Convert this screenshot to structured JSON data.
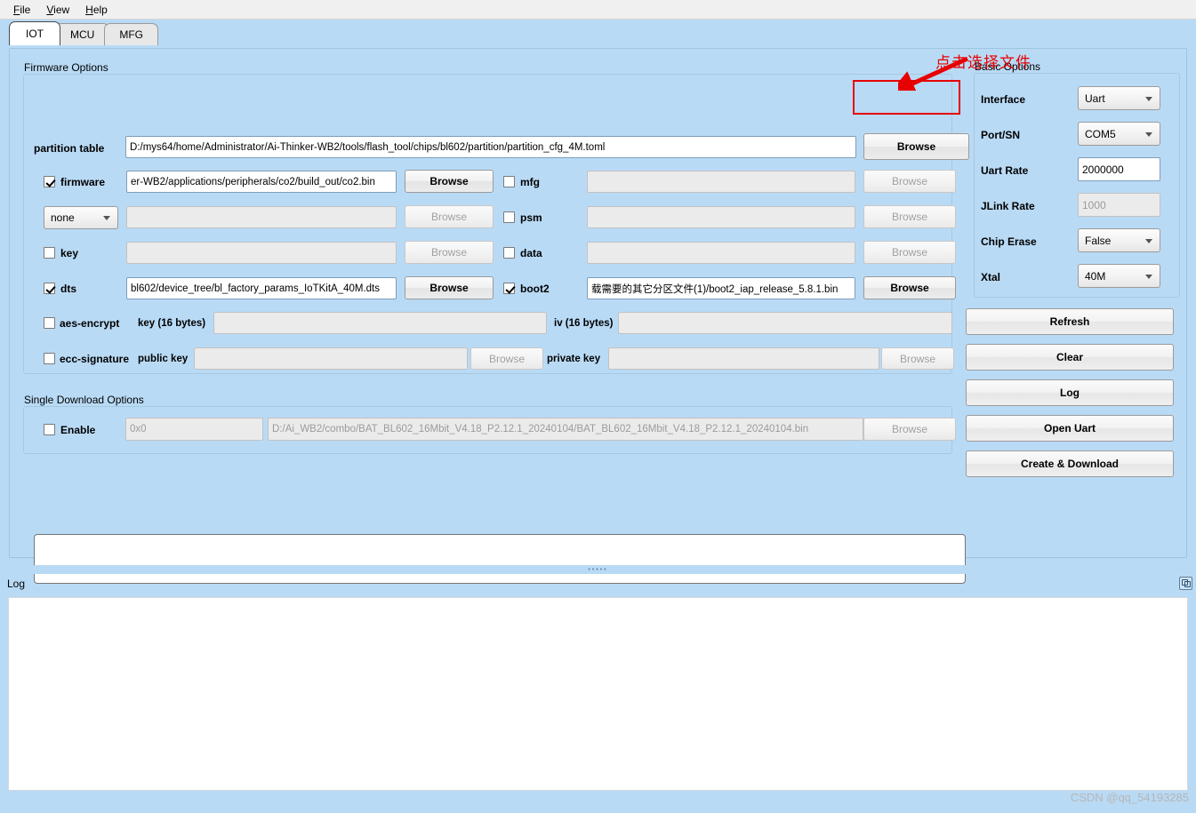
{
  "colors": {
    "background": "#b9daf5",
    "accent_red": "#e60000",
    "panel_white": "#ffffff",
    "disabled_text": "#9b9b9b"
  },
  "menubar": {
    "items": [
      {
        "label": "File",
        "accel": "F"
      },
      {
        "label": "View",
        "accel": "V"
      },
      {
        "label": "Help",
        "accel": "H"
      }
    ]
  },
  "tabs": [
    {
      "label": "IOT",
      "active": true
    },
    {
      "label": "MCU",
      "active": false
    },
    {
      "label": "MFG",
      "active": false
    }
  ],
  "firmware_options": {
    "title": "Firmware Options",
    "partition_table": {
      "label": "partition table",
      "value": "D:/mys64/home/Administrator/Ai-Thinker-WB2/tools/flash_tool/chips/bl602/partition/partition_cfg_4M.toml",
      "browse_label": "Browse"
    },
    "rows_left": [
      {
        "name": "firmware",
        "label": "firmware",
        "checked": true,
        "is_combo": false,
        "value": "er-WB2/applications/peripherals/co2/build_out/co2.bin",
        "browse_label": "Browse",
        "browse_enabled": true
      },
      {
        "name": "none-select",
        "label": "none",
        "checked": false,
        "is_combo": true,
        "value": "",
        "browse_label": "Browse",
        "browse_enabled": false
      },
      {
        "name": "key",
        "label": "key",
        "checked": false,
        "is_combo": false,
        "value": "",
        "browse_label": "Browse",
        "browse_enabled": false
      },
      {
        "name": "dts",
        "label": "dts",
        "checked": true,
        "is_combo": false,
        "value": "bl602/device_tree/bl_factory_params_IoTKitA_40M.dts",
        "browse_label": "Browse",
        "browse_enabled": true
      }
    ],
    "rows_right": [
      {
        "name": "mfg",
        "label": "mfg",
        "checked": false,
        "value": "",
        "browse_label": "Browse",
        "browse_enabled": false
      },
      {
        "name": "psm",
        "label": "psm",
        "checked": false,
        "value": "",
        "browse_label": "Browse",
        "browse_enabled": false
      },
      {
        "name": "data",
        "label": "data",
        "checked": false,
        "value": "",
        "browse_label": "Browse",
        "browse_enabled": false
      },
      {
        "name": "boot2",
        "label": "boot2",
        "checked": true,
        "value": "载需要的其它分区文件(1)/boot2_iap_release_5.8.1.bin",
        "browse_label": "Browse",
        "browse_enabled": true
      }
    ],
    "aes_encrypt": {
      "label": "aes-encrypt",
      "checked": false,
      "key_label": "key (16 bytes)",
      "key_value": "",
      "iv_label": "iv (16 bytes)",
      "iv_value": ""
    },
    "ecc_signature": {
      "label": "ecc-signature",
      "checked": false,
      "public_key_label": "public key",
      "public_key_value": "",
      "public_browse_label": "Browse",
      "private_key_label": "private key",
      "private_key_value": "",
      "private_browse_label": "Browse"
    }
  },
  "single_download_options": {
    "title": "Single Download Options",
    "enable_label": "Enable",
    "enabled": false,
    "address_placeholder": "0x0",
    "address_value": "",
    "file_value": "D:/Ai_WB2/combo/BAT_BL602_16Mbit_V4.18_P2.12.1_20240104/BAT_BL602_16Mbit_V4.18_P2.12.1_20240104.bin",
    "browse_label": "Browse"
  },
  "basic_options": {
    "title": "Basic Options",
    "fields": [
      {
        "name": "interface",
        "label": "Interface",
        "value": "Uart",
        "type": "combo",
        "enabled": true
      },
      {
        "name": "port-sn",
        "label": "Port/SN",
        "value": "COM5",
        "type": "combo",
        "enabled": true
      },
      {
        "name": "uart-rate",
        "label": "Uart Rate",
        "value": "2000000",
        "type": "text",
        "enabled": true
      },
      {
        "name": "jlink-rate",
        "label": "JLink Rate",
        "value": "1000",
        "type": "text",
        "enabled": false
      },
      {
        "name": "chip-erase",
        "label": "Chip Erase",
        "value": "False",
        "type": "combo",
        "enabled": true
      },
      {
        "name": "xtal",
        "label": "Xtal",
        "value": "40M",
        "type": "combo",
        "enabled": true
      }
    ]
  },
  "action_buttons": [
    {
      "name": "refresh",
      "label": "Refresh"
    },
    {
      "name": "clear",
      "label": "Clear"
    },
    {
      "name": "log",
      "label": "Log"
    },
    {
      "name": "open-uart",
      "label": "Open Uart"
    },
    {
      "name": "create-download",
      "label": "Create & Download"
    }
  ],
  "log_dock": {
    "title": "Log",
    "content": ""
  },
  "annotation": {
    "text": "点击选择文件"
  },
  "watermark": "CSDN @qq_54193285"
}
